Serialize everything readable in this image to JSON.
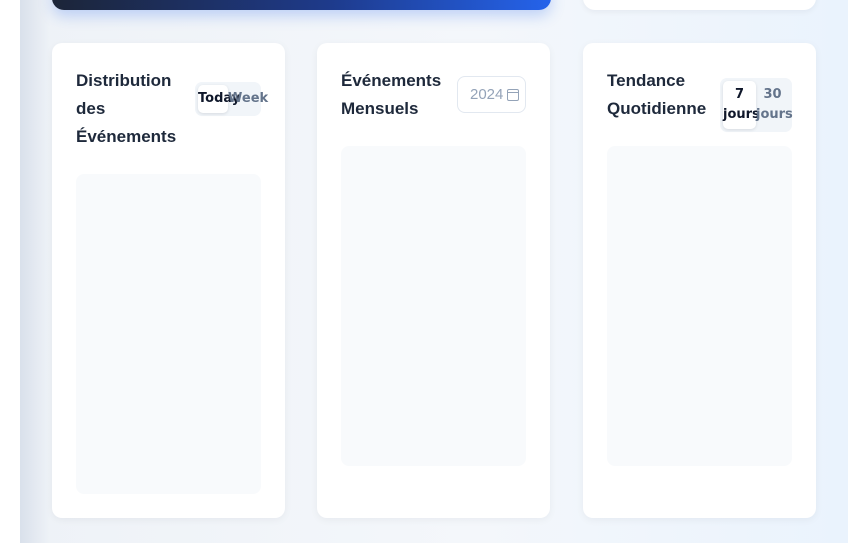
{
  "cards": [
    {
      "title": "Distribution des Événements",
      "toggle": [
        "Today",
        "Week"
      ],
      "active": 0
    },
    {
      "title": "Événements Mensuels",
      "date_value": "2024"
    },
    {
      "title": "Tendance Quotidienne",
      "toggle": [
        "7 jours",
        "30 jours"
      ],
      "active": 0
    }
  ],
  "colors": {
    "banner_start": "#1c2538",
    "banner_end": "#2563eb",
    "title_text": "#1e293b",
    "muted_text": "#64748b"
  },
  "icons": [
    "calendar-icon"
  ]
}
